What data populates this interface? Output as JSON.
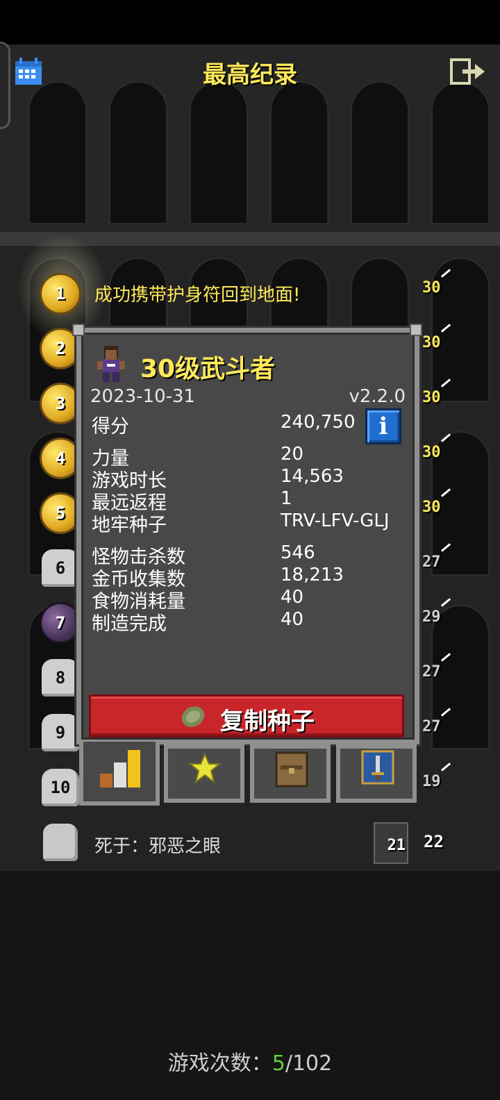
{
  "header": {
    "title": "最高纪录",
    "calendar_icon": "calendar-icon",
    "exit_icon": "exit-icon"
  },
  "records": [
    {
      "rank": "1",
      "text": "成功携带护身符回到地面!",
      "level": "30",
      "badge": "gold"
    },
    {
      "rank": "2",
      "text": "",
      "level": "30",
      "badge": "gold"
    },
    {
      "rank": "3",
      "text": "",
      "level": "30",
      "badge": "gold"
    },
    {
      "rank": "4",
      "text": "",
      "level": "30",
      "badge": "gold"
    },
    {
      "rank": "5",
      "text": "",
      "level": "30",
      "badge": "gold"
    },
    {
      "rank": "6",
      "text": "",
      "level": "27",
      "badge": "stone"
    },
    {
      "rank": "7",
      "text": "",
      "level": "29",
      "badge": "dark"
    },
    {
      "rank": "8",
      "text": "",
      "level": "27",
      "badge": "stone"
    },
    {
      "rank": "9",
      "text": "",
      "level": "27",
      "badge": "stone"
    },
    {
      "rank": "10",
      "text": "",
      "level": "19",
      "badge": "stone"
    }
  ],
  "latest": {
    "text": "死于：邪恶之眼",
    "depth": "21",
    "level": "22"
  },
  "details": {
    "title": "30级武斗者",
    "date": "2023-10-31",
    "version": "v2.2.0",
    "stats": [
      {
        "label": "得分",
        "value": "240,750"
      },
      {
        "label": "力量",
        "value": "20"
      },
      {
        "label": "游戏时长",
        "value": "14,563"
      },
      {
        "label": "最远返程",
        "value": "1"
      },
      {
        "label": "地牢种子",
        "value": "TRV-LFV-GLJ"
      },
      {
        "label": "怪物击杀数",
        "value": "546"
      },
      {
        "label": "金币收集数",
        "value": "18,213"
      },
      {
        "label": "食物消耗量",
        "value": "40"
      },
      {
        "label": "制造完成",
        "value": "40"
      }
    ],
    "info_button": "i",
    "copy_seed_label": "复制种子"
  },
  "tabs": [
    {
      "name": "stats-tab",
      "icon": "bar-chart-icon"
    },
    {
      "name": "badges-tab",
      "icon": "star-icon"
    },
    {
      "name": "inventory-tab",
      "icon": "backpack-icon"
    },
    {
      "name": "talents-tab",
      "icon": "sword-icon"
    }
  ],
  "footer": {
    "label": "游戏次数：",
    "current": "5",
    "total": "/102"
  },
  "colors": {
    "title_yellow": "#ffe95a",
    "copy_button_red": "#c8262a",
    "info_blue": "#1f6fd0",
    "current_green": "#5fcf3b"
  }
}
